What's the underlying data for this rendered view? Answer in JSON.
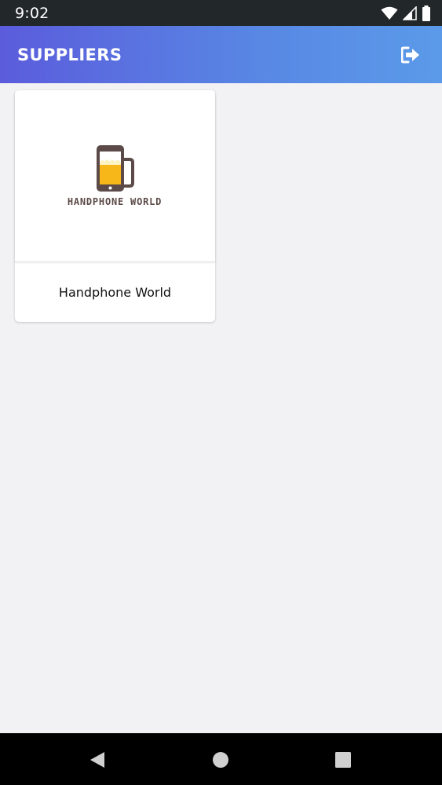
{
  "status_bar": {
    "time": "9:02",
    "icons": [
      "wifi-icon",
      "cell-signal-icon",
      "battery-icon"
    ]
  },
  "app_bar": {
    "title": "SUPPLIERS",
    "action_icon": "logout-icon",
    "gradient": [
      "#5b5cdc",
      "#5b9ae9"
    ]
  },
  "suppliers": [
    {
      "name": "Handphone World",
      "logo_text": "HANDPHONE WORLD",
      "logo_colors": {
        "mug": "#5b4a47",
        "beer": "#f7b719",
        "foam": "#fff3c4"
      }
    }
  ],
  "nav_bar": {
    "buttons": [
      "back-icon",
      "home-icon",
      "recents-icon"
    ]
  }
}
